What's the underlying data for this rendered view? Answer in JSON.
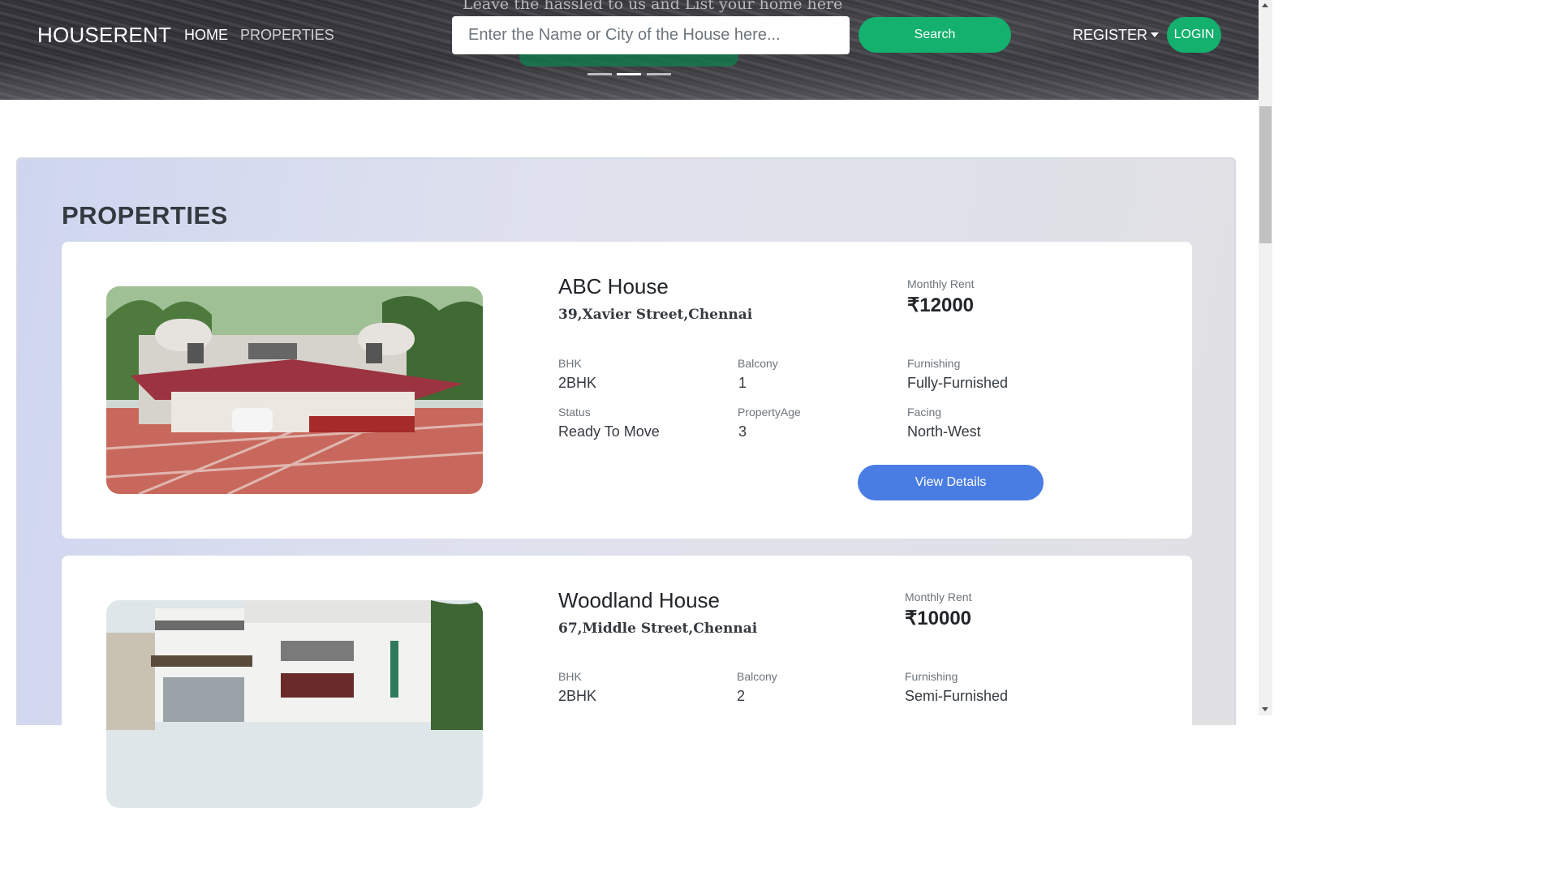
{
  "hero": {
    "tagline": "Leave the hassled to us and List your home here"
  },
  "navbar": {
    "brand": "HOUSERENT",
    "home": "HOME",
    "properties": "PROPERTIES",
    "search_placeholder": "Enter the Name or City of the House here...",
    "search_button": "Search",
    "register": "REGISTER",
    "login": "LOGIN"
  },
  "section": {
    "title": "PROPERTIES"
  },
  "properties": [
    {
      "name": "ABC House",
      "address": "39,Xavier Street,Chennai",
      "rent_label": "Monthly Rent",
      "rent": "₹12000",
      "bhk_label": "BHK",
      "bhk": "2BHK",
      "balcony_label": "Balcony",
      "balcony": "1",
      "furnishing_label": "Furnishing",
      "furnishing": "Fully-Furnished",
      "status_label": "Status",
      "status": "Ready To Move",
      "age_label": "PropertyAge",
      "age": "3",
      "facing_label": "Facing",
      "facing": "North-West",
      "button": "View Details"
    },
    {
      "name": "Woodland House",
      "address": "67,Middle Street,Chennai",
      "rent_label": "Monthly Rent",
      "rent": "₹10000",
      "bhk_label": "BHK",
      "bhk": "2BHK",
      "balcony_label": "Balcony",
      "balcony": "2",
      "furnishing_label": "Furnishing",
      "furnishing": "Semi-Furnished"
    }
  ],
  "colors": {
    "accent_green": "#13b06e",
    "accent_blue": "#4a7de3"
  }
}
